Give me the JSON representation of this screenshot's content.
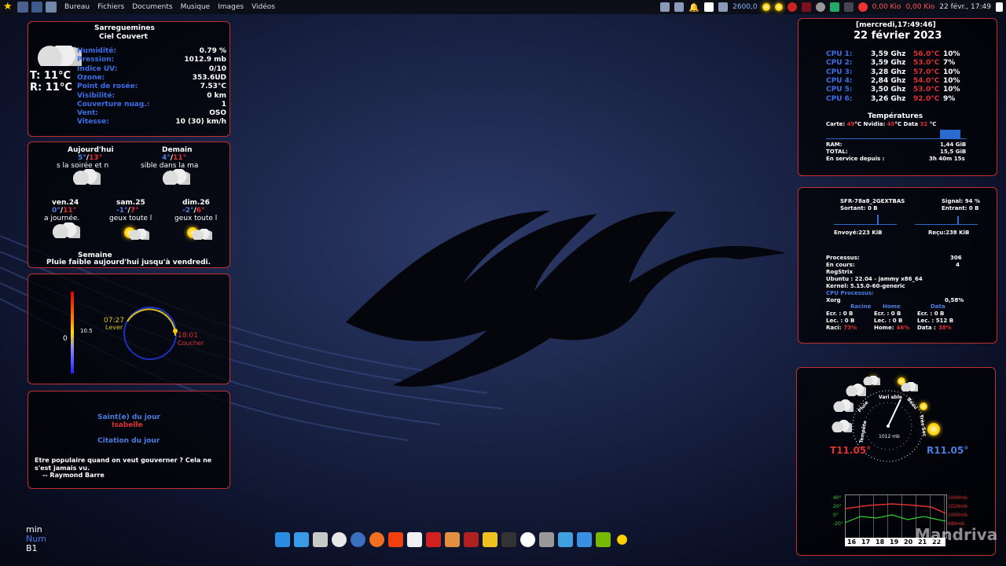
{
  "topbar": {
    "menu": [
      "Bureau",
      "Fichiers",
      "Documents",
      "Musique",
      "Images",
      "Vidéos"
    ],
    "cpu_freq": "2600,0",
    "net_down": "0,00 Kio",
    "net_up": "0,00 Kio",
    "clock": "22 févr., 17:49"
  },
  "weather_now": {
    "city": "Sarreguemines",
    "condition": "Ciel Couvert",
    "temp": "T: 11°C",
    "feel": "R: 11°C",
    "rows": [
      {
        "label": "Humidité:",
        "value": "0.79 %"
      },
      {
        "label": "Pression:",
        "value": "1012.9 mb"
      },
      {
        "label": "Indice UV:",
        "value": "0/10"
      },
      {
        "label": "Ozone:",
        "value": "353.6UD"
      },
      {
        "label": "Point de rosée:",
        "value": "7.53°C"
      },
      {
        "label": "Visibilité:",
        "value": "0 km"
      },
      {
        "label": "Couverture nuag.:",
        "value": "1"
      },
      {
        "label": "Vent:",
        "value": "OSO"
      },
      {
        "label": "Vitesse:",
        "value": "10 (30) km/h"
      }
    ]
  },
  "forecast": {
    "today": {
      "title": "Aujourd'hui",
      "min": "5°",
      "max": "13°",
      "desc": "s la soirée et n"
    },
    "tomorrow": {
      "title": "Demain",
      "min": "4°",
      "max": "11°",
      "desc": "sible dans la ma"
    },
    "days": [
      {
        "title": "ven.24",
        "min": "0°",
        "max": "11°",
        "desc": "a journée."
      },
      {
        "title": "sam.25",
        "min": "-1°",
        "max": "7°",
        "desc": "geux toute l"
      },
      {
        "title": "dim.26",
        "min": "-2°",
        "max": "6°",
        "desc": "geux toute l"
      }
    ],
    "week_title": "Semaine",
    "week_text": "Pluie faible aujourd'hui jusqu'à vendredi."
  },
  "sun": {
    "thermo_value": "10.5",
    "thermo_zero": "0",
    "sunrise": "07:27",
    "sunrise_label": "Lever",
    "sunset": "18:01",
    "sunset_label": "Coucher"
  },
  "saint": {
    "title": "Saint(e) du jour",
    "name": "Isabelle",
    "quote_title": "Citation du jour",
    "quote": "Etre populaire quand on veut gouverner ? Cela ne s'est jamais vu.",
    "author": "-- Raymond Barre"
  },
  "lock_keys": {
    "min": "min",
    "num": "Num",
    "b1": "B1"
  },
  "system": {
    "datetime": "[mercredi,17:49:46]",
    "date": "22 février 2023",
    "cpus": [
      {
        "label": "CPU 1:",
        "freq": "3,59 Ghz",
        "temp": "56.0°C",
        "load": "10%"
      },
      {
        "label": "CPU 2:",
        "freq": "3,59 Ghz",
        "temp": "53.0°C",
        "load": "7%"
      },
      {
        "label": "CPU 3:",
        "freq": "3,28 Ghz",
        "temp": "57.0°C",
        "load": "10%"
      },
      {
        "label": "CPU 4:",
        "freq": "2,84 Ghz",
        "temp": "54.0°C",
        "load": "10%"
      },
      {
        "label": "CPU 5:",
        "freq": "3,50 Ghz",
        "temp": "53.0°C",
        "load": "10%"
      },
      {
        "label": "CPU 6:",
        "freq": "3,26 Ghz",
        "temp": "92.0°C",
        "load": "9%"
      }
    ],
    "temps_title": "Températures",
    "carte_label": "Carte:",
    "carte": "49",
    "nvidia_label": "Nvidia:",
    "nvidia": "45",
    "data_label": "Data",
    "data": "32",
    "deg": "°C",
    "ram_label": "RAM:",
    "ram": "1,44 GiB",
    "total_label": "TOTAL:",
    "total": "15,5 GiB",
    "uptime_label": "En service depuis :",
    "uptime": "3h 40m 15s"
  },
  "network": {
    "ssid": "SFR-78a8_2GEXTBAS",
    "signal": "Signal: 94 %",
    "out": "Sortant: 0 B",
    "in": "Entrant: 0 B",
    "sent": "Envoyé:223 KiB",
    "recv": "Reçu:238 KiB",
    "proc_label": "Processus:",
    "proc": "306",
    "running_label": "En cours:",
    "running": "4",
    "host": "RogStrix",
    "ubuntu": "Ubuntu : 22.04 - jammy  x86_64",
    "kernel": "Kernel: 5.15.0-60-generic",
    "cpu_proc_title": "CPU Processus:",
    "top_proc": "Xorg",
    "top_proc_val": "0,58%",
    "disk_headers": [
      "Racine",
      "Home",
      "Data"
    ],
    "disks": [
      {
        "ecr": "Ecr. : 0 B",
        "lec": "Lec. : 0 B",
        "use_label": "Raci:",
        "use": "73%"
      },
      {
        "ecr": "Ecr. : 0 B",
        "lec": "Lec. : 0 B",
        "use_label": "Home:",
        "use": "46%"
      },
      {
        "ecr": "Ecr. : 0 B",
        "lec": "Lec. : 512 B",
        "use_label": "Data :",
        "use": "38%"
      }
    ]
  },
  "gauge": {
    "temp": "T11.05°",
    "feel": "R11.05°",
    "pressure": "1012 mb",
    "dial_labels": [
      "Tempête",
      "Pluie",
      "Vari able",
      "Beau",
      "Très Sec"
    ],
    "y_left": [
      "40°",
      "20°",
      "0°",
      "-20°"
    ],
    "y_right": [
      "1040mb",
      "1020mb",
      "1000mb",
      "980mb"
    ],
    "x": [
      "16",
      "17",
      "18",
      "19",
      "20",
      "21",
      "22"
    ],
    "watermark": "Mandriva"
  },
  "colors": {
    "border": "#c03030",
    "accent": "#4a7de0",
    "hot": "#e03030"
  }
}
